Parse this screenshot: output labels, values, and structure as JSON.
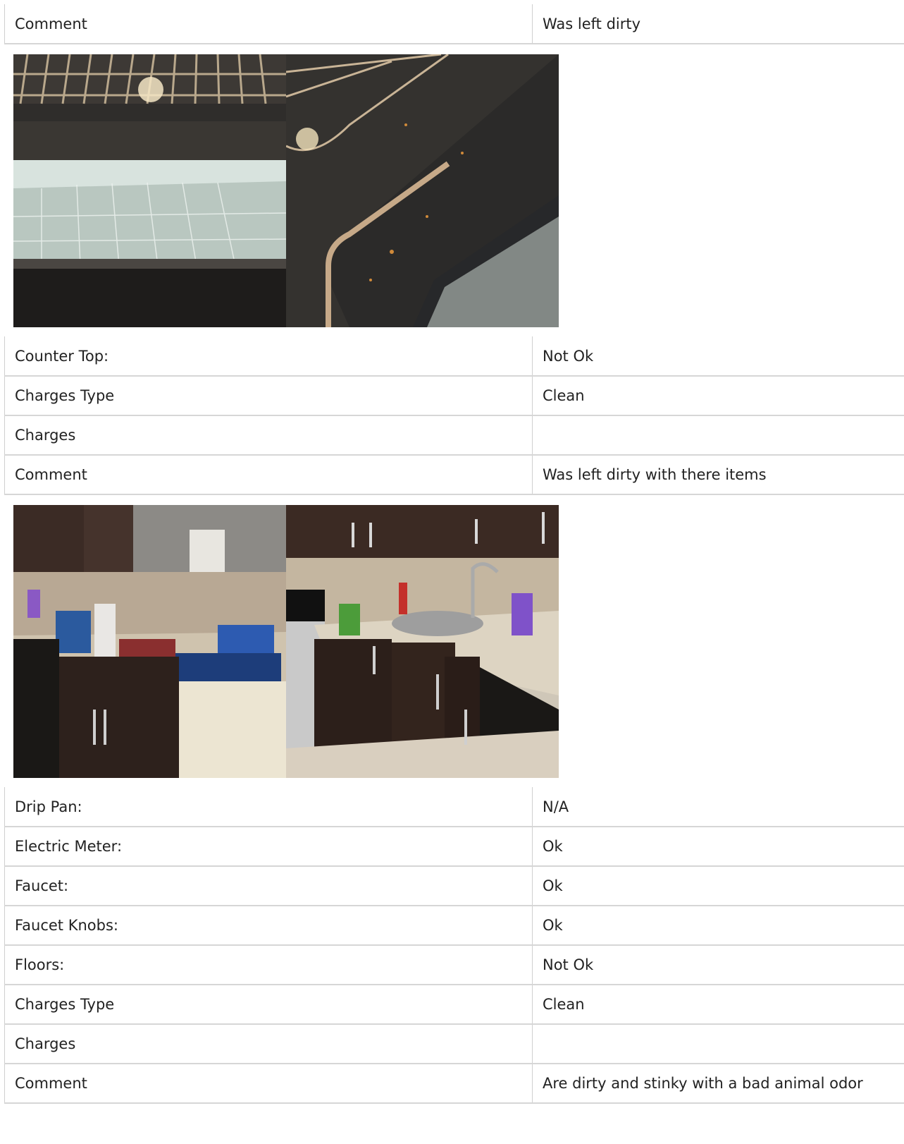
{
  "sections": {
    "oven_comment": {
      "label": "Comment",
      "value": "Was left dirty"
    },
    "counter_top": {
      "label": "Counter Top:",
      "value": "Not Ok"
    },
    "counter_charges_type": {
      "label": "Charges Type",
      "value": "Clean"
    },
    "counter_charges": {
      "label": "Charges",
      "value": ""
    },
    "counter_comment": {
      "label": "Comment",
      "value": "Was left dirty with there items"
    },
    "drip_pan": {
      "label": "Drip Pan:",
      "value": "N/A"
    },
    "electric_meter": {
      "label": "Electric Meter:",
      "value": "Ok"
    },
    "faucet": {
      "label": "Faucet:",
      "value": "Ok"
    },
    "faucet_knobs": {
      "label": "Faucet Knobs:",
      "value": "Ok"
    },
    "floors": {
      "label": "Floors:",
      "value": "Not Ok"
    },
    "floors_charges_type": {
      "label": "Charges Type",
      "value": "Clean"
    },
    "floors_charges": {
      "label": "Charges",
      "value": ""
    },
    "floors_comment": {
      "label": "Comment",
      "value": "Are dirty and stinky with a bad animal odor"
    }
  },
  "colors": {
    "row_border": "#d6d6d6",
    "text": "#222222",
    "background": "#ffffff"
  }
}
